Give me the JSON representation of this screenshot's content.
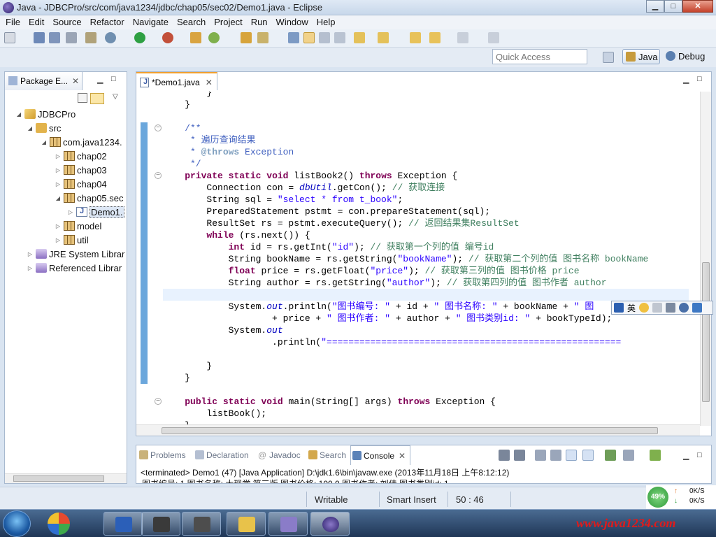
{
  "window": {
    "title": "Java - JDBCPro/src/com/java1234/jdbc/chap05/sec02/Demo1.java - Eclipse",
    "minimize_glyph": "▁",
    "maximize_glyph": "□",
    "close_glyph": "✕"
  },
  "menu": [
    "File",
    "Edit",
    "Source",
    "Refactor",
    "Navigate",
    "Search",
    "Project",
    "Run",
    "Window",
    "Help"
  ],
  "quick_access": {
    "placeholder": "Quick Access"
  },
  "perspectives": [
    {
      "label": "Java",
      "active": true,
      "icon": "java-perspective-icon"
    },
    {
      "label": "Debug",
      "active": false,
      "icon": "debug-perspective-icon"
    }
  ],
  "package_explorer": {
    "tab_label": "Package E...",
    "tree": [
      {
        "label": "JDBCPro",
        "depth": 0,
        "expanded": true,
        "icon": "project"
      },
      {
        "label": "src",
        "depth": 1,
        "expanded": true,
        "icon": "folder"
      },
      {
        "label": "com.java1234.",
        "depth": 2,
        "expanded": true,
        "icon": "package"
      },
      {
        "label": "chap02",
        "depth": 3,
        "expanded": false,
        "icon": "package"
      },
      {
        "label": "chap03",
        "depth": 3,
        "expanded": false,
        "icon": "package"
      },
      {
        "label": "chap04",
        "depth": 3,
        "expanded": false,
        "icon": "package"
      },
      {
        "label": "chap05.sec",
        "depth": 3,
        "expanded": true,
        "icon": "package"
      },
      {
        "label": "Demo1.",
        "depth": 4,
        "expanded": false,
        "icon": "java",
        "selected": true
      },
      {
        "label": "model",
        "depth": 3,
        "expanded": false,
        "icon": "package"
      },
      {
        "label": "util",
        "depth": 3,
        "expanded": false,
        "icon": "package"
      },
      {
        "label": "JRE System Librar",
        "depth": 1,
        "expanded": false,
        "icon": "library"
      },
      {
        "label": "Referenced Librar",
        "depth": 1,
        "expanded": false,
        "icon": "library"
      }
    ]
  },
  "editor": {
    "tab_label": "*Demo1.java",
    "lines": [
      [
        {
          "t": "        }"
        }
      ],
      [
        {
          "t": "    }"
        }
      ],
      [
        {
          "t": ""
        }
      ],
      [
        {
          "t": "    /**",
          "c": "jdoc"
        }
      ],
      [
        {
          "t": "     * 遍历查询结果",
          "c": "jdoc"
        }
      ],
      [
        {
          "t": "     * ",
          "c": "jdoc"
        },
        {
          "t": "@throws",
          "c": "jtag"
        },
        {
          "t": " Exception",
          "c": "jdoc"
        }
      ],
      [
        {
          "t": "     */",
          "c": "jdoc"
        }
      ],
      [
        {
          "t": "    "
        },
        {
          "t": "private",
          "c": "kw"
        },
        {
          "t": " "
        },
        {
          "t": "static",
          "c": "kw"
        },
        {
          "t": " "
        },
        {
          "t": "void",
          "c": "kw"
        },
        {
          "t": " listBook2() "
        },
        {
          "t": "throws",
          "c": "kw"
        },
        {
          "t": " Exception {"
        }
      ],
      [
        {
          "t": "        Connection con = "
        },
        {
          "t": "dbUtil",
          "c": "fld"
        },
        {
          "t": ".getCon(); "
        },
        {
          "t": "// 获取连接",
          "c": "com"
        }
      ],
      [
        {
          "t": "        String sql = "
        },
        {
          "t": "\"select * from t_book\"",
          "c": "str"
        },
        {
          "t": ";"
        }
      ],
      [
        {
          "t": "        PreparedStatement pstmt = con.prepareStatement(sql);"
        }
      ],
      [
        {
          "t": "        ResultSet rs = pstmt.executeQuery(); "
        },
        {
          "t": "// 返回结果集ResultSet",
          "c": "com"
        }
      ],
      [
        {
          "t": "        "
        },
        {
          "t": "while",
          "c": "kw"
        },
        {
          "t": " (rs.next()) {"
        }
      ],
      [
        {
          "t": "            "
        },
        {
          "t": "int",
          "c": "kw"
        },
        {
          "t": " id = rs.getInt("
        },
        {
          "t": "\"id\"",
          "c": "str"
        },
        {
          "t": "); "
        },
        {
          "t": "// 获取第一个列的值 编号id",
          "c": "com"
        }
      ],
      [
        {
          "t": "            String bookName = rs.getString("
        },
        {
          "t": "\"bookName\"",
          "c": "str"
        },
        {
          "t": "); "
        },
        {
          "t": "// 获取第二个列的值 图书名称 bookName",
          "c": "com"
        }
      ],
      [
        {
          "t": "            "
        },
        {
          "t": "float",
          "c": "kw"
        },
        {
          "t": " price = rs.getFloat("
        },
        {
          "t": "\"price\"",
          "c": "str"
        },
        {
          "t": "); "
        },
        {
          "t": "// 获取第三列的值 图书价格 price",
          "c": "com"
        }
      ],
      [
        {
          "t": "            String author = rs.getString("
        },
        {
          "t": "\"author\"",
          "c": "str"
        },
        {
          "t": "); "
        },
        {
          "t": "// 获取第四列的值 图书作者 author",
          "c": "com"
        }
      ],
      [
        {
          "t": "            "
        },
        {
          "t": "int",
          "c": "kw"
        },
        {
          "t": " bookTypeId = rs.getInt(5); "
        },
        {
          "t": "// 获取第五列的值 图书类别id",
          "c": "com"
        }
      ],
      [
        {
          "t": "            System."
        },
        {
          "t": "out",
          "c": "fld"
        },
        {
          "t": ".println("
        },
        {
          "t": "\"图书编号: \"",
          "c": "str"
        },
        {
          "t": " + id + "
        },
        {
          "t": "\" 图书名称: \"",
          "c": "str"
        },
        {
          "t": " + bookName + "
        },
        {
          "t": "\" 图",
          "c": "str"
        }
      ],
      [
        {
          "t": "                    + price + "
        },
        {
          "t": "\" 图书作者: \"",
          "c": "str"
        },
        {
          "t": " + author + "
        },
        {
          "t": "\" 图书类别id: \"",
          "c": "str"
        },
        {
          "t": " + bookTypeId);"
        }
      ],
      [
        {
          "t": "            System."
        },
        {
          "t": "out",
          "c": "fld"
        }
      ],
      [
        {
          "t": "                    .println("
        },
        {
          "t": "\"======================================================",
          "c": "str"
        }
      ],
      [
        {
          "t": ""
        }
      ],
      [
        {
          "t": "        }"
        }
      ],
      [
        {
          "t": "    }"
        }
      ],
      [
        {
          "t": ""
        }
      ],
      [
        {
          "t": "    "
        },
        {
          "t": "public",
          "c": "kw"
        },
        {
          "t": " "
        },
        {
          "t": "static",
          "c": "kw"
        },
        {
          "t": " "
        },
        {
          "t": "void",
          "c": "kw"
        },
        {
          "t": " main(String[] args) "
        },
        {
          "t": "throws",
          "c": "kw"
        },
        {
          "t": " Exception {"
        }
      ],
      [
        {
          "t": "        listBook();"
        }
      ],
      [
        {
          "t": "    }"
        }
      ]
    ]
  },
  "ime_toolbar": {
    "lang_label": "英"
  },
  "bottom_views": {
    "tabs": [
      {
        "label": "Problems",
        "icon": "problems-icon",
        "active": false
      },
      {
        "label": "Declaration",
        "icon": "declaration-icon",
        "active": false
      },
      {
        "label": "Javadoc",
        "icon": "javadoc-icon",
        "active": false
      },
      {
        "label": "Search",
        "icon": "search-icon",
        "active": false
      },
      {
        "label": "Console",
        "icon": "console-icon",
        "active": true
      }
    ],
    "console_header": "<terminated> Demo1 (47) [Java Application] D:\\jdk1.6\\bin\\javaw.exe (2013年11月18日 上午8:12:12)",
    "console_output": "图书编号: 1 图书名称: 大现学 第三版 图书价格: 100.0 图书作者: 刘佳 图书类别id: 1"
  },
  "status_bar": {
    "writable": "Writable",
    "insert_mode": "Smart Insert",
    "position": "50 : 46"
  },
  "network_widget": {
    "percent": "49%",
    "up": "0K/S",
    "down": "0K/S"
  },
  "taskbar": {
    "apps": [
      "word-app-icon",
      "terminal-app-icon",
      "java-app-icon",
      "help-app-icon",
      "media-app-icon",
      "eclipse-app-icon"
    ],
    "watermark": "www.java1234.com"
  }
}
